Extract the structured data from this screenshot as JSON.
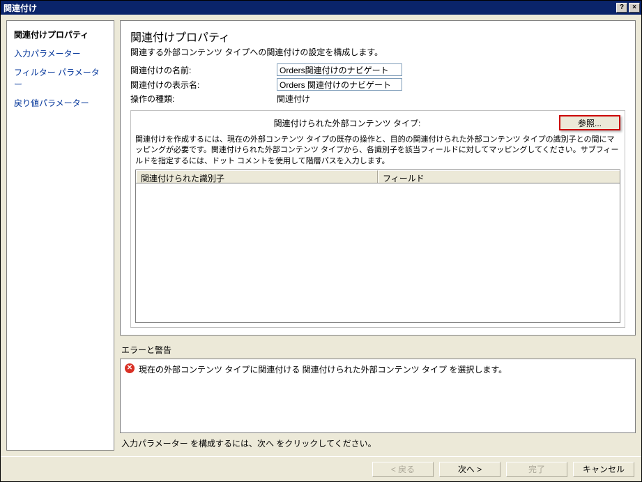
{
  "titlebar": {
    "title": "関連付け",
    "help": "?",
    "close": "×"
  },
  "sidebar": {
    "items": [
      {
        "label": "関連付けプロパティ",
        "selected": true
      },
      {
        "label": "入力パラメーター",
        "selected": false
      },
      {
        "label": "フィルター パラメーター",
        "selected": false
      },
      {
        "label": "戻り値パラメーター",
        "selected": false
      }
    ]
  },
  "panel": {
    "heading": "関連付けプロパティ",
    "subheading": "関連する外部コンテンツ タイプへの関連付けの設定を構成します。",
    "name_label": "関連付けの名前:",
    "name_value": "Orders関連付けのナビゲート",
    "display_label": "関連付けの表示名:",
    "display_value": "Orders 関連付けのナビゲート",
    "op_label": "操作の種類:",
    "op_value": "関連付け"
  },
  "section": {
    "title": "関連付けられた外部コンテンツ タイプ:",
    "browse": "参照...",
    "help": "関連付けを作成するには、現在の外部コンテンツ タイプの既存の操作と、目的の関連付けられた外部コンテンツ タイプの識別子との間にマッピングが必要です。関連付けられた外部コンテンツ タイプから、各識別子を該当フィールドに対してマッピングしてください。サブフィールドを指定するには、ドット コメントを使用して階層パスを入力します。",
    "col1": "関連付けられた識別子",
    "col2": "フィールド"
  },
  "errors": {
    "title": "エラーと警告",
    "items": [
      {
        "icon": "error",
        "text": "現在の外部コンテンツ タイプに関連付ける 関連付けられた外部コンテンツ タイプ を選択します。"
      }
    ]
  },
  "footer_hint": "入力パラメーター を構成するには、次へ をクリックしてください。",
  "buttons": {
    "back": "< 戻る",
    "next": "次へ >",
    "finish": "完了",
    "cancel": "キャンセル"
  }
}
